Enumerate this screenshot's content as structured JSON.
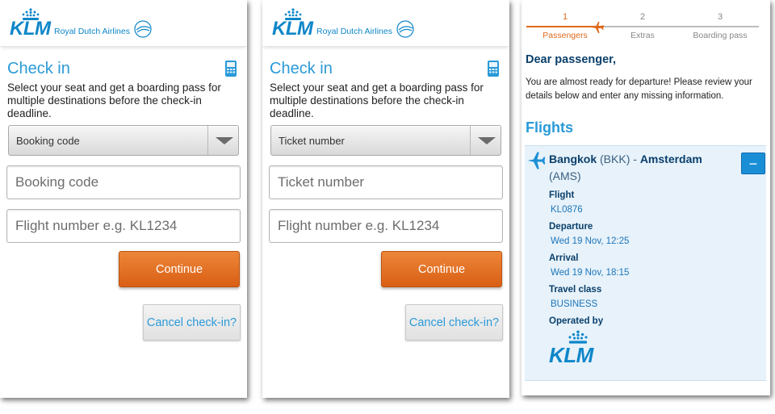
{
  "brand": {
    "logo_text": "KLM",
    "tagline": "Royal Dutch Airlines",
    "accent_color": "#0e86c9",
    "action_color": "#e06a1b"
  },
  "screen1": {
    "title": "Check in",
    "intro": "Select your seat and get a boarding pass for multiple destinations before the check-in deadline.",
    "select_value": "Booking code",
    "field1_placeholder": "Booking code",
    "field2_placeholder": "Flight number e.g. KL1234",
    "continue_label": "Continue",
    "cancel_label": "Cancel check-in?"
  },
  "screen2": {
    "title": "Check in",
    "intro": "Select your seat and get a boarding pass for multiple destinations before the check-in deadline.",
    "select_value": "Ticket number",
    "field1_placeholder": "Ticket number",
    "field2_placeholder": "Flight number e.g. KL1234",
    "continue_label": "Continue",
    "cancel_label": "Cancel check-in?"
  },
  "screen3": {
    "steps": [
      {
        "num": "1",
        "label": "Passengers"
      },
      {
        "num": "2",
        "label": "Extras"
      },
      {
        "num": "3",
        "label": "Boarding pass"
      }
    ],
    "greeting": "Dear passenger,",
    "message": "You are almost ready for departure! Please review your details below and enter any missing information.",
    "flights_heading": "Flights",
    "flight": {
      "origin_city": "Bangkok",
      "origin_code": "(BKK)",
      "separator": "-",
      "dest_city": "Amsterdam",
      "dest_code": "(AMS)",
      "collapse_label": "−",
      "flight_label": "Flight",
      "flight_value": "KL0876",
      "departure_label": "Departure",
      "departure_value": "Wed 19 Nov, 12:25",
      "arrival_label": "Arrival",
      "arrival_value": "Wed 19 Nov, 18:15",
      "class_label": "Travel class",
      "class_value": "BUSINESS",
      "operated_label": "Operated by",
      "operator_logo": "KLM"
    }
  }
}
